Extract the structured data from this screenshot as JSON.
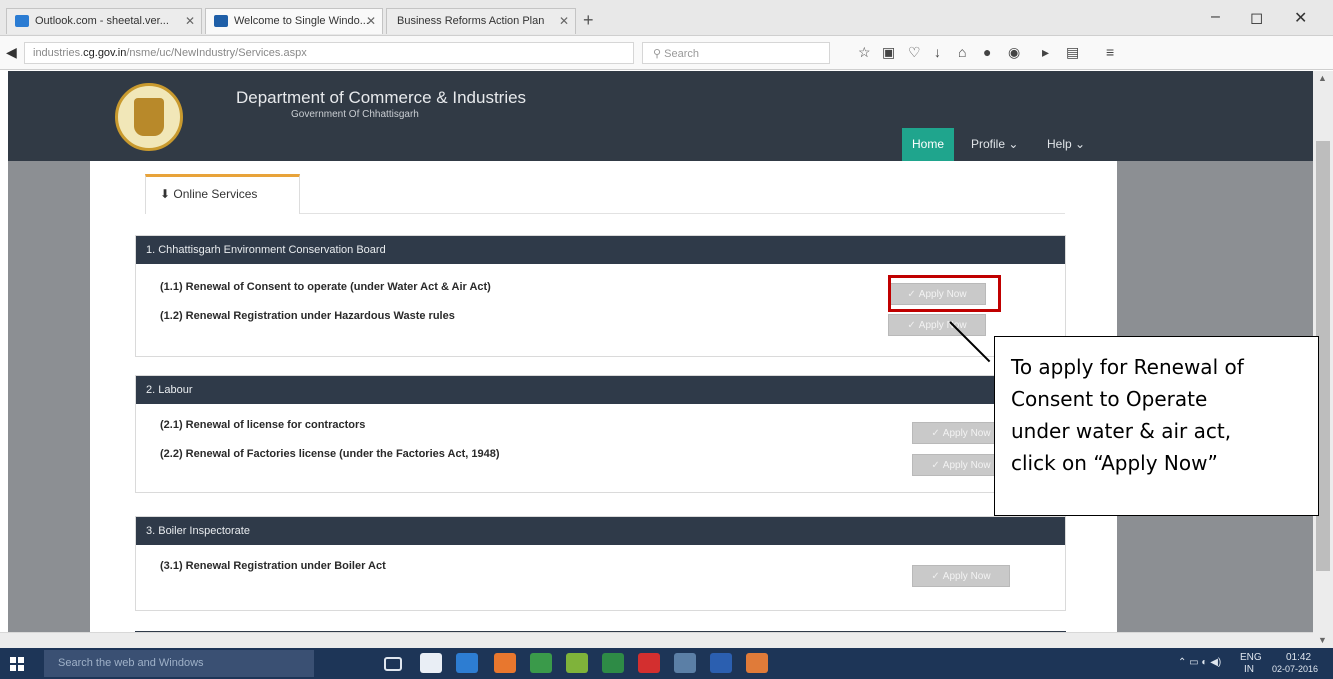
{
  "browser": {
    "tabs": [
      {
        "title": "Outlook.com - sheetal.ver...",
        "favicon_color": "#2b7cd3"
      },
      {
        "title": "Welcome to Single Windo...",
        "favicon_color": "#1f5fa8"
      },
      {
        "title": "Business Reforms Action Plan",
        "favicon_color": "#cccccc"
      }
    ],
    "url_prefix": "industries.",
    "url_domain": "cg.gov.in",
    "url_path": "/nsme/uc/NewIndustry/Services.aspx",
    "search_placeholder": "Search"
  },
  "site": {
    "title": "Department of Commerce & Industries",
    "subtitle": "Government Of Chhattisgarh",
    "menu": [
      {
        "label": "Home"
      },
      {
        "label": "Profile ⌄"
      },
      {
        "label": "Help ⌄"
      }
    ]
  },
  "services_tab": {
    "label": "Online Services"
  },
  "sections": [
    {
      "header": "1. Chhattisgarh Environment Conservation Board",
      "items": [
        {
          "label": "(1.1) Renewal of Consent to operate (under Water Act & Air Act)",
          "button": "Apply Now"
        },
        {
          "label": "(1.2) Renewal Registration under Hazardous Waste rules",
          "button": "Apply Now"
        }
      ]
    },
    {
      "header": "2. Labour",
      "items": [
        {
          "label": "(2.1) Renewal of license for contractors",
          "button": "Apply Now"
        },
        {
          "label": "(2.2) Renewal of Factories license (under the Factories Act, 1948)",
          "button": "Apply Now"
        }
      ]
    },
    {
      "header": "3. Boiler Inspectorate",
      "items": [
        {
          "label": "(3.1) Renewal Registration under Boiler Act",
          "button": "Apply Now"
        }
      ]
    }
  ],
  "callout": {
    "lines": [
      "To apply for Renewal of",
      "Consent to Operate",
      "under water & air act,",
      "click on “Apply Now”"
    ]
  },
  "taskbar": {
    "search_placeholder": "Search the web and Windows",
    "lang": "ENG",
    "region": "IN",
    "time": "01:42",
    "date": "02-07-2016"
  },
  "colors": {
    "header_bg": "#313a45",
    "active_menu": "#1fa58d",
    "tab_accent": "#e8a33a",
    "highlight": "#c00000"
  }
}
